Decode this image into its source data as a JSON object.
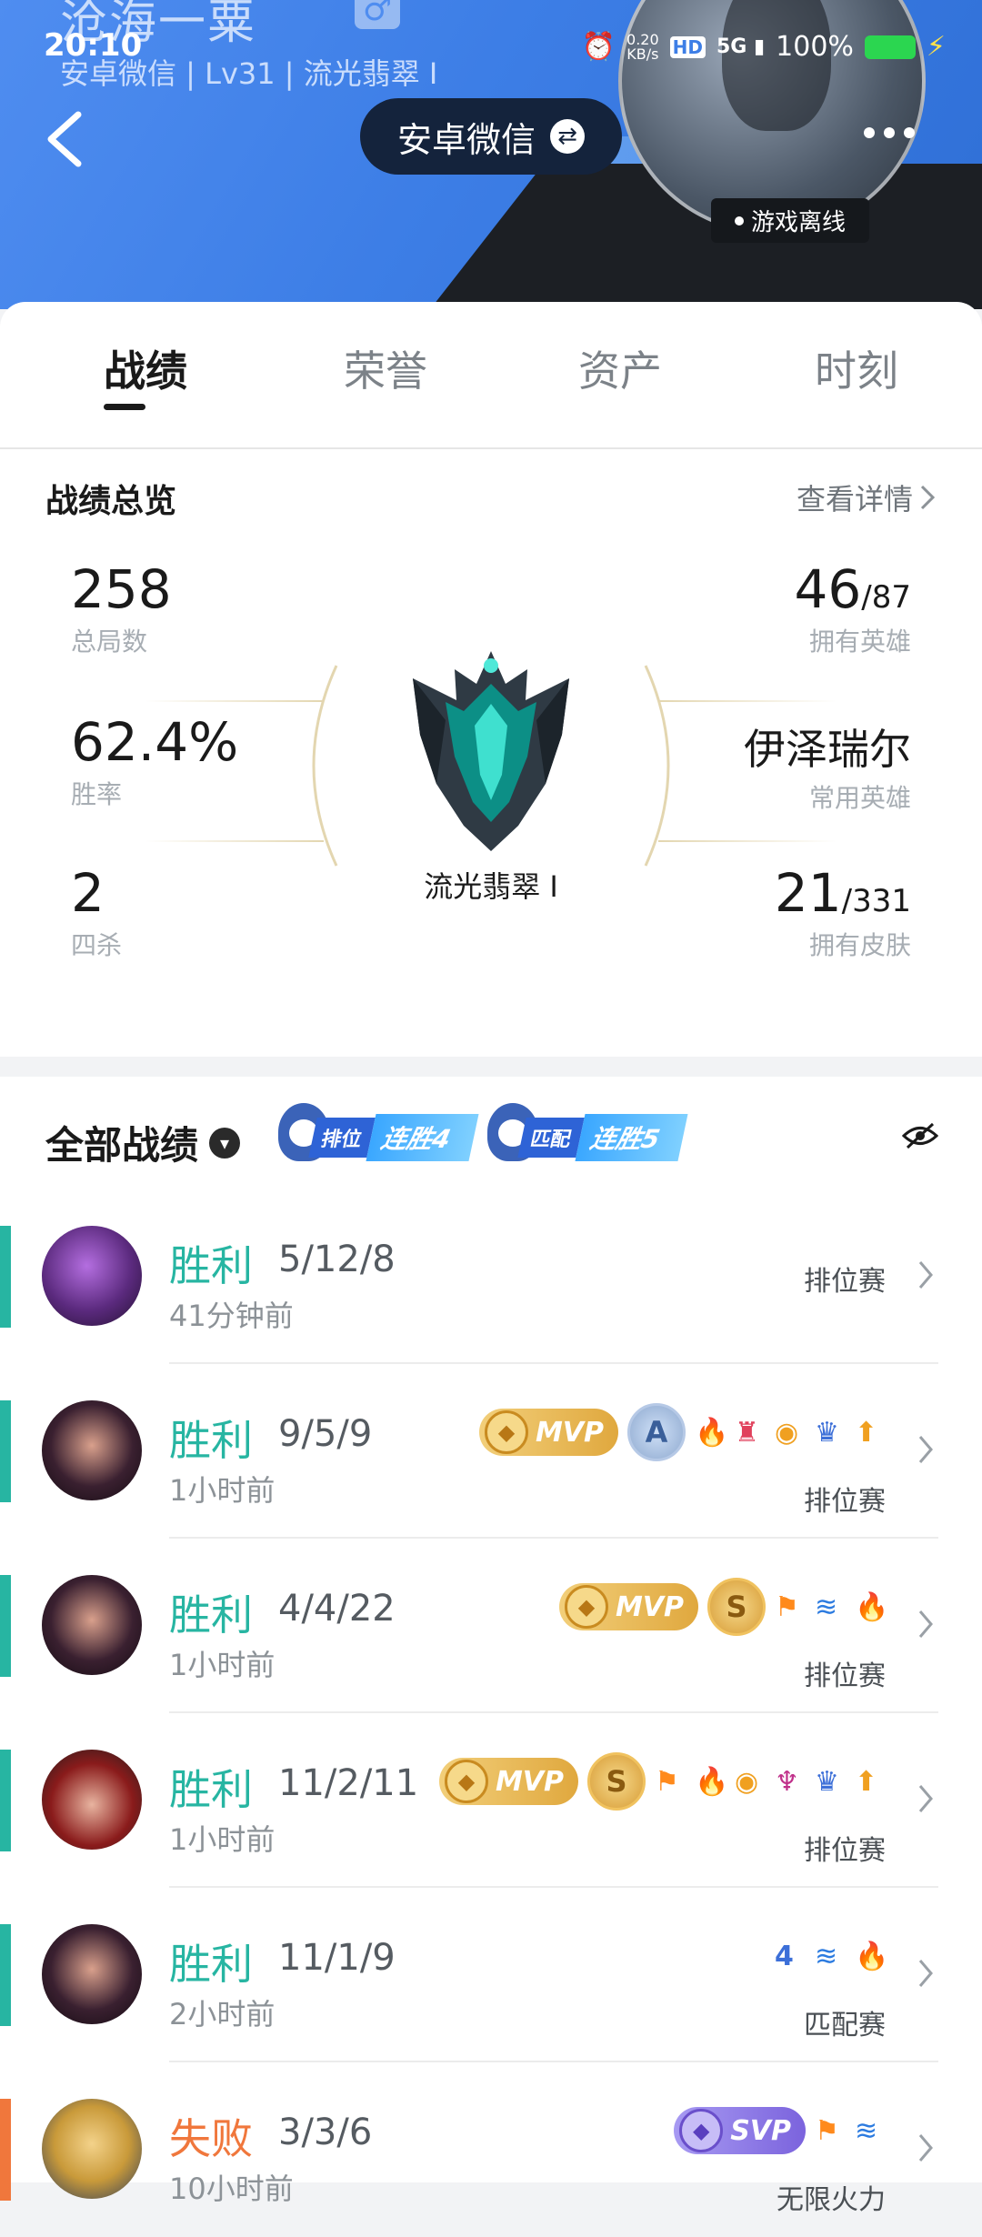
{
  "status_bar": {
    "time": "20:10",
    "net_speed_value": "0.20",
    "net_speed_unit": "KB/s",
    "hd": "HD",
    "network": "5G",
    "battery": "100%"
  },
  "profile": {
    "name": "沧海一粟",
    "sub_info": "安卓微信 | Lv31 | 流光翡翠 Ⅰ",
    "switch_label": "安卓微信",
    "online_status": "游戏离线"
  },
  "tabs": [
    {
      "label": "战绩",
      "active": true
    },
    {
      "label": "荣誉",
      "active": false
    },
    {
      "label": "资产",
      "active": false
    },
    {
      "label": "时刻",
      "active": false
    }
  ],
  "overview": {
    "title": "战绩总览",
    "detail_link": "查看详情",
    "total_games": {
      "value": "258",
      "label": "总局数"
    },
    "win_rate": {
      "value": "62.4%",
      "label": "胜率"
    },
    "quadra_kills": {
      "value": "2",
      "label": "四杀"
    },
    "heroes_owned": {
      "value": "46",
      "total": "/87",
      "label": "拥有英雄"
    },
    "common_hero": {
      "value": "伊泽瑞尔",
      "label": "常用英雄"
    },
    "skins_owned": {
      "value": "21",
      "total": "/331",
      "label": "拥有皮肤"
    },
    "rank_name": "流光翡翠 Ⅰ"
  },
  "records": {
    "title": "全部战绩",
    "streaks": [
      {
        "type": "排位",
        "text": "连胜4"
      },
      {
        "type": "匹配",
        "text": "连胜5"
      }
    ],
    "matches": [
      {
        "result": "胜利",
        "outcome": "win",
        "kda": "5/12/8",
        "time": "41分钟前",
        "mode": "排位赛",
        "badges": [],
        "hero_color": "#5b2a7e"
      },
      {
        "result": "胜利",
        "outcome": "win",
        "kda": "9/5/9",
        "time": "1小时前",
        "mode": "排位赛",
        "badges": [
          "MVP",
          "A"
        ],
        "hero_color": "#3a2030"
      },
      {
        "result": "胜利",
        "outcome": "win",
        "kda": "4/4/22",
        "time": "1小时前",
        "mode": "排位赛",
        "badges": [
          "MVP",
          "S"
        ],
        "hero_color": "#3a2030"
      },
      {
        "result": "胜利",
        "outcome": "win",
        "kda": "11/2/11",
        "time": "1小时前",
        "mode": "排位赛",
        "badges": [
          "MVP",
          "S"
        ],
        "hero_color": "#8a1b1b"
      },
      {
        "result": "胜利",
        "outcome": "win",
        "kda": "11/1/9",
        "time": "2小时前",
        "mode": "匹配赛",
        "badges": [],
        "hero_color": "#3a2030"
      },
      {
        "result": "失败",
        "outcome": "lose",
        "kda": "3/3/6",
        "time": "10小时前",
        "mode": "无限火力",
        "badges": [
          "SVP"
        ],
        "hero_color": "#c99a3a"
      }
    ],
    "mvp_label": "MVP",
    "svp_label": "SVP"
  },
  "colors": {
    "win": "#27b5a2",
    "lose": "#f0773c",
    "header_blue": "#3d7ee6"
  }
}
